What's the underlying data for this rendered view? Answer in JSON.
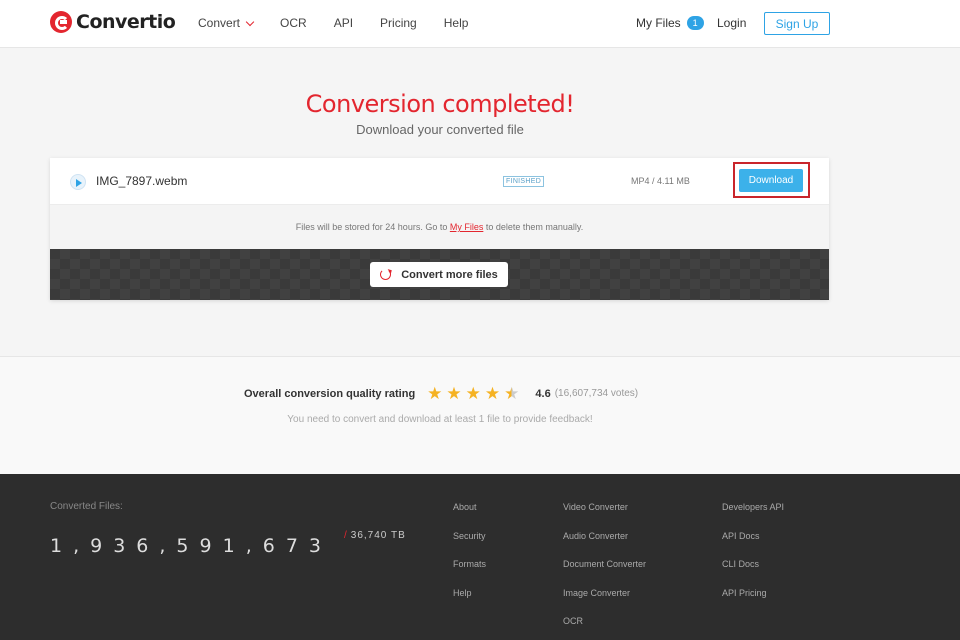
{
  "header": {
    "logo_text": "Convertio",
    "nav": [
      {
        "label": "Convert"
      },
      {
        "label": "OCR"
      },
      {
        "label": "API"
      },
      {
        "label": "Pricing"
      },
      {
        "label": "Help"
      }
    ],
    "my_files_label": "My Files",
    "my_files_count": "1",
    "login_label": "Login",
    "signup_label": "Sign Up"
  },
  "hero": {
    "title": "Conversion completed!",
    "subtitle": "Download your converted file"
  },
  "file": {
    "name": "IMG_7897.webm",
    "status": "FINISHED",
    "info": "MP4 / 4.11 MB",
    "download_label": "Download"
  },
  "storage": {
    "text_before": "Files will be stored for 24 hours. Go to ",
    "link_label": "My Files",
    "text_after": " to delete them manually."
  },
  "convert_more_label": "Convert more files",
  "rating": {
    "label": "Overall conversion quality rating",
    "score": "4.6",
    "stars_value": 4.6,
    "votes": "(16,607,734 votes)",
    "feedback": "You need to convert and download at least 1 file to provide feedback!"
  },
  "footer": {
    "converted_label": "Converted Files:",
    "converted_count": "1,936,591,673",
    "tb": "36,740 TB",
    "col1": [
      "About",
      "Security",
      "Formats",
      "Help"
    ],
    "col2": [
      "Video Converter",
      "Audio Converter",
      "Document Converter",
      "Image Converter",
      "OCR"
    ],
    "col3": [
      "Developers API",
      "API Docs",
      "CLI Docs",
      "API Pricing"
    ]
  },
  "colors": {
    "brand_red": "#e3262f",
    "accent_blue": "#2ea3e5",
    "star": "#f5b223"
  }
}
